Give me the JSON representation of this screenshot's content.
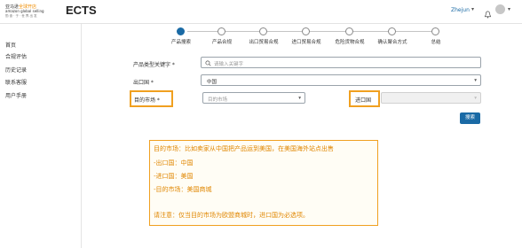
{
  "header": {
    "logo_line1_a": "亚马逊",
    "logo_line1_b": "全球开店",
    "logo_line2": "amazon global selling",
    "logo_line3": "勤 奋 · 于 · 世 界 出 发",
    "app_title": "ECTS",
    "user_name": "Zhejun",
    "user_caret": "▾",
    "avatar_caret": "▾"
  },
  "sidebar": {
    "items": [
      {
        "label": "首页"
      },
      {
        "label": "合规评估"
      },
      {
        "label": "历史记录"
      },
      {
        "label": "联系客服"
      },
      {
        "label": "用户手册"
      }
    ]
  },
  "stepper": {
    "active_index": 0,
    "steps": [
      {
        "label": "产品搜索"
      },
      {
        "label": "产品合规"
      },
      {
        "label": "出口贸易合规"
      },
      {
        "label": "进口贸易合规"
      },
      {
        "label": "危险货物合规"
      },
      {
        "label": "确认聚合方式"
      },
      {
        "label": "总结"
      }
    ]
  },
  "form": {
    "keyword_label": "产品类型关键字 *",
    "keyword_placeholder": "请输入关键字",
    "export_label": "出口国 *",
    "export_value": "中国",
    "market_label": "目的市场 *",
    "market_placeholder": "目的市场",
    "import_label": "进口国",
    "search_button": "搜索",
    "caret": "▾"
  },
  "note": {
    "line1": "目的市场：比如卖家从中国把产品运到美国，在美国海外站点出售",
    "line2": "-出口国：中国",
    "line3": "-进口国：美国",
    "line4": "-目的市场：美国商城",
    "line5": "请注意：仅当目的市场为欧盟商城时，进口国为必选项。"
  },
  "colors": {
    "accent": "#1a6aa5",
    "highlight": "#f0a020"
  }
}
